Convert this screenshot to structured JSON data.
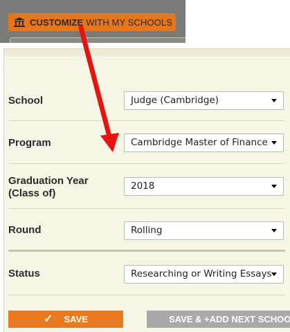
{
  "banner": {
    "button_bold": "CUSTOMIZE",
    "button_rest": "WITH MY SCHOOLS"
  },
  "form": {
    "school": {
      "label": "School",
      "value": "Judge (Cambridge)"
    },
    "program": {
      "label": "Program",
      "value": "Cambridge Master of Finance"
    },
    "graduation": {
      "label_line1": "Graduation Year",
      "label_line2": "(Class of)",
      "value": "2018"
    },
    "round": {
      "label": "Round",
      "value": "Rolling"
    },
    "status": {
      "label": "Status",
      "value": "Researching or Writing Essays"
    }
  },
  "actions": {
    "save_label": "SAVE",
    "save_next_label": "SAVE & +ADD NEXT SCHOOL"
  },
  "colors": {
    "accent": "#e5761c",
    "panel_bg": "#f7f5e6",
    "annotation_arrow": "#e8120f"
  },
  "icons": {
    "banner_icon": "institution-icon",
    "save_icon": "checkmark-icon",
    "dropdown_icon": "caret-down-icon"
  }
}
